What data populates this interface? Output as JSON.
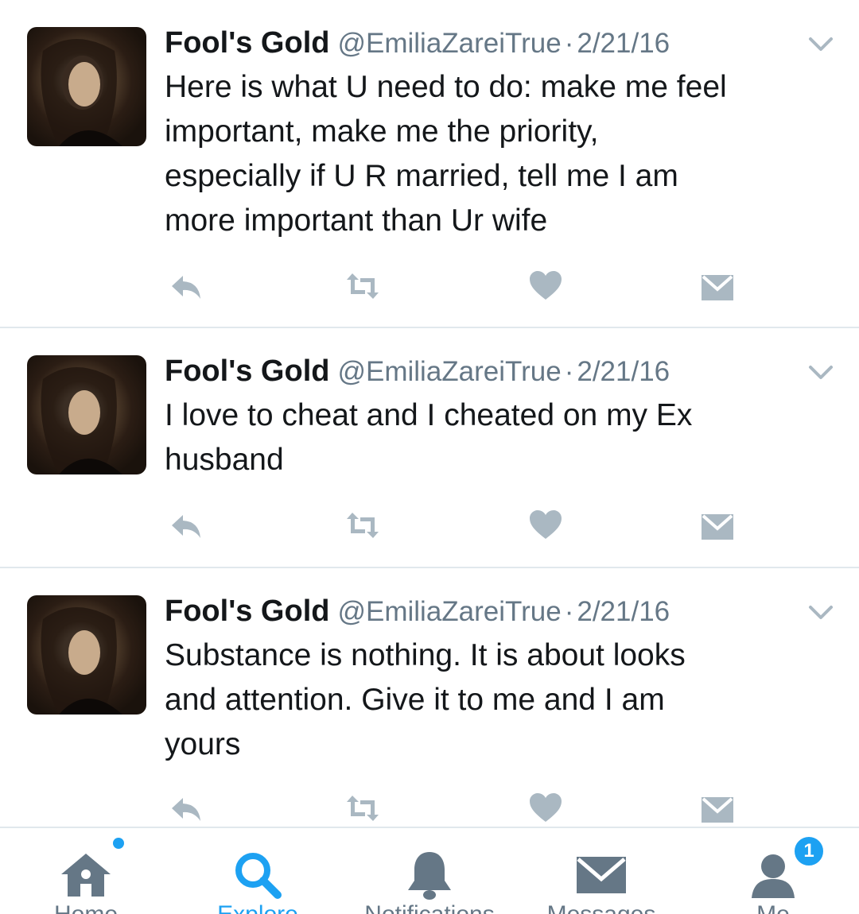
{
  "tweets": [
    {
      "name": "Fool's Gold",
      "handle": "@EmiliaZareiTrue",
      "separator": "·",
      "date": "2/21/16",
      "text": "Here is what U need to do: make me feel\nimportant, make me the priority,\nespecially if U R married, tell me I am\nmore important than Ur wife",
      "avatar_icon": "profile-photo"
    },
    {
      "name": "Fool's Gold",
      "handle": "@EmiliaZareiTrue",
      "separator": "·",
      "date": "2/21/16",
      "text": "I love to cheat and I cheated on my Ex\nhusband",
      "avatar_icon": "profile-photo"
    },
    {
      "name": "Fool's Gold",
      "handle": "@EmiliaZareiTrue",
      "separator": "·",
      "date": "2/21/16",
      "text": "Substance is nothing.  It is about looks\nand attention.  Give it to me and I am\nyours",
      "avatar_icon": "profile-photo"
    }
  ],
  "action_icons": [
    "reply-icon",
    "retweet-icon",
    "like-icon",
    "direct-message-icon"
  ],
  "tabbar": {
    "tabs": [
      {
        "label": "Home",
        "icon": "home-icon"
      },
      {
        "label": "Explore",
        "icon": "search-icon"
      },
      {
        "label": "Notifications",
        "icon": "bell-icon"
      },
      {
        "label": "Messages",
        "icon": "envelope-icon"
      },
      {
        "label": "Me",
        "icon": "profile-icon",
        "badge": "1"
      }
    ]
  },
  "colors": {
    "accent": "#1da1f2",
    "icon_gray": "#aab8c2",
    "secondary_text": "#657786",
    "divider": "#e1e8ed"
  }
}
